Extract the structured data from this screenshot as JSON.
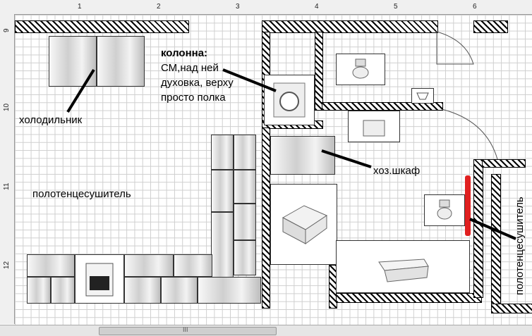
{
  "ruler": {
    "top_ticks": [
      "1",
      "2",
      "3",
      "4",
      "5",
      "6"
    ],
    "left_ticks": [
      "9",
      "10",
      "11",
      "12"
    ]
  },
  "labels": {
    "fridge": "холодильник",
    "towel_dryer_left": "полотенцесушитель",
    "column_title": "колонна:",
    "column_text_1": "СМ,над ней",
    "column_text_2": "духовка, верху",
    "column_text_3": "просто полка",
    "utility_cabinet": "хоз.шкаф",
    "towel_dryer_right": "полотенцесушитель"
  },
  "colors": {
    "heater": "#e02020",
    "wall_hatch": "#000000",
    "grid": "#cfcfcf"
  },
  "scrollbar": {
    "thumb_text": "III"
  }
}
